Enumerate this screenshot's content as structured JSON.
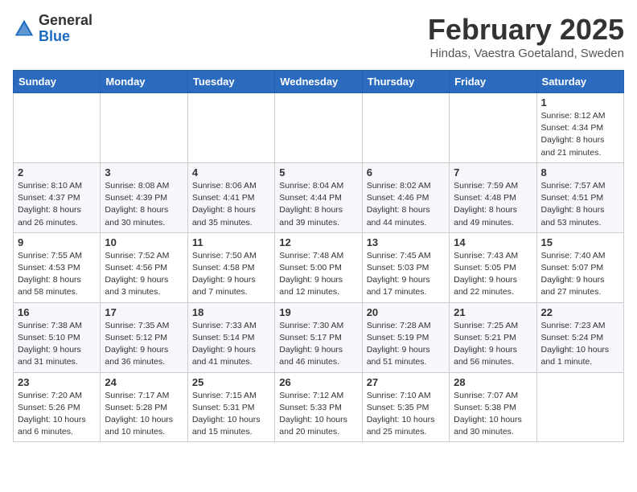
{
  "header": {
    "logo": {
      "general": "General",
      "blue": "Blue"
    },
    "title": "February 2025",
    "subtitle": "Hindas, Vaestra Goetaland, Sweden"
  },
  "weekdays": [
    "Sunday",
    "Monday",
    "Tuesday",
    "Wednesday",
    "Thursday",
    "Friday",
    "Saturday"
  ],
  "weeks": [
    [
      {
        "day": "",
        "info": ""
      },
      {
        "day": "",
        "info": ""
      },
      {
        "day": "",
        "info": ""
      },
      {
        "day": "",
        "info": ""
      },
      {
        "day": "",
        "info": ""
      },
      {
        "day": "",
        "info": ""
      },
      {
        "day": "1",
        "info": "Sunrise: 8:12 AM\nSunset: 4:34 PM\nDaylight: 8 hours and 21 minutes."
      }
    ],
    [
      {
        "day": "2",
        "info": "Sunrise: 8:10 AM\nSunset: 4:37 PM\nDaylight: 8 hours and 26 minutes."
      },
      {
        "day": "3",
        "info": "Sunrise: 8:08 AM\nSunset: 4:39 PM\nDaylight: 8 hours and 30 minutes."
      },
      {
        "day": "4",
        "info": "Sunrise: 8:06 AM\nSunset: 4:41 PM\nDaylight: 8 hours and 35 minutes."
      },
      {
        "day": "5",
        "info": "Sunrise: 8:04 AM\nSunset: 4:44 PM\nDaylight: 8 hours and 39 minutes."
      },
      {
        "day": "6",
        "info": "Sunrise: 8:02 AM\nSunset: 4:46 PM\nDaylight: 8 hours and 44 minutes."
      },
      {
        "day": "7",
        "info": "Sunrise: 7:59 AM\nSunset: 4:48 PM\nDaylight: 8 hours and 49 minutes."
      },
      {
        "day": "8",
        "info": "Sunrise: 7:57 AM\nSunset: 4:51 PM\nDaylight: 8 hours and 53 minutes."
      }
    ],
    [
      {
        "day": "9",
        "info": "Sunrise: 7:55 AM\nSunset: 4:53 PM\nDaylight: 8 hours and 58 minutes."
      },
      {
        "day": "10",
        "info": "Sunrise: 7:52 AM\nSunset: 4:56 PM\nDaylight: 9 hours and 3 minutes."
      },
      {
        "day": "11",
        "info": "Sunrise: 7:50 AM\nSunset: 4:58 PM\nDaylight: 9 hours and 7 minutes."
      },
      {
        "day": "12",
        "info": "Sunrise: 7:48 AM\nSunset: 5:00 PM\nDaylight: 9 hours and 12 minutes."
      },
      {
        "day": "13",
        "info": "Sunrise: 7:45 AM\nSunset: 5:03 PM\nDaylight: 9 hours and 17 minutes."
      },
      {
        "day": "14",
        "info": "Sunrise: 7:43 AM\nSunset: 5:05 PM\nDaylight: 9 hours and 22 minutes."
      },
      {
        "day": "15",
        "info": "Sunrise: 7:40 AM\nSunset: 5:07 PM\nDaylight: 9 hours and 27 minutes."
      }
    ],
    [
      {
        "day": "16",
        "info": "Sunrise: 7:38 AM\nSunset: 5:10 PM\nDaylight: 9 hours and 31 minutes."
      },
      {
        "day": "17",
        "info": "Sunrise: 7:35 AM\nSunset: 5:12 PM\nDaylight: 9 hours and 36 minutes."
      },
      {
        "day": "18",
        "info": "Sunrise: 7:33 AM\nSunset: 5:14 PM\nDaylight: 9 hours and 41 minutes."
      },
      {
        "day": "19",
        "info": "Sunrise: 7:30 AM\nSunset: 5:17 PM\nDaylight: 9 hours and 46 minutes."
      },
      {
        "day": "20",
        "info": "Sunrise: 7:28 AM\nSunset: 5:19 PM\nDaylight: 9 hours and 51 minutes."
      },
      {
        "day": "21",
        "info": "Sunrise: 7:25 AM\nSunset: 5:21 PM\nDaylight: 9 hours and 56 minutes."
      },
      {
        "day": "22",
        "info": "Sunrise: 7:23 AM\nSunset: 5:24 PM\nDaylight: 10 hours and 1 minute."
      }
    ],
    [
      {
        "day": "23",
        "info": "Sunrise: 7:20 AM\nSunset: 5:26 PM\nDaylight: 10 hours and 6 minutes."
      },
      {
        "day": "24",
        "info": "Sunrise: 7:17 AM\nSunset: 5:28 PM\nDaylight: 10 hours and 10 minutes."
      },
      {
        "day": "25",
        "info": "Sunrise: 7:15 AM\nSunset: 5:31 PM\nDaylight: 10 hours and 15 minutes."
      },
      {
        "day": "26",
        "info": "Sunrise: 7:12 AM\nSunset: 5:33 PM\nDaylight: 10 hours and 20 minutes."
      },
      {
        "day": "27",
        "info": "Sunrise: 7:10 AM\nSunset: 5:35 PM\nDaylight: 10 hours and 25 minutes."
      },
      {
        "day": "28",
        "info": "Sunrise: 7:07 AM\nSunset: 5:38 PM\nDaylight: 10 hours and 30 minutes."
      },
      {
        "day": "",
        "info": ""
      }
    ]
  ]
}
